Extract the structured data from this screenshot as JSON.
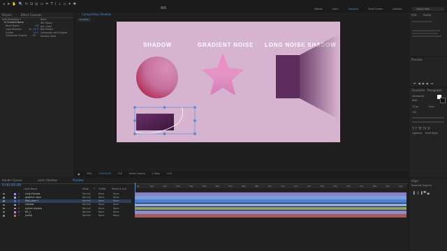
{
  "menu": {
    "items": [
      "Default",
      "Learn",
      "Standard",
      "Small Screen",
      "Libraries"
    ],
    "search_placeholder": "Search Help"
  },
  "project_panel": {
    "tab_project": "Project",
    "tab_effect_controls": "Effect Controls",
    "layer_name": "Solid Backplate 1",
    "effect_title": "fx Gradient Noise",
    "props": [
      {
        "label": "Bevel Depth",
        "value": "100"
      },
      {
        "label": "Light Direction",
        "value": "0x -45.0°"
      },
      {
        "label": "Scatter",
        "value": "10.0"
      },
      {
        "label": "Composite Original",
        "value": "Off"
      }
    ],
    "right_col": [
      "None",
      "Tall Glossy",
      "Adj. Layer",
      "Blur Radius",
      "Composite with Original",
      "Random Seed"
    ]
  },
  "composition": {
    "tab_label": "Composition Shadow",
    "breadcrumb": "Shadow",
    "canvas_titles": {
      "shadow": "SHADOW",
      "gradient": "GRADIENT NOISE",
      "long": "LONG NOISE SHADOW"
    },
    "footer": {
      "zoom": "50%",
      "timecode": "0:00:00:00",
      "quality": "Full",
      "camera": "Active Camera",
      "views": "1 View",
      "offset": "+0.0"
    }
  },
  "right_panel": {
    "info_title": "Info",
    "audio_title": "Audio",
    "preview_title": "Preview",
    "character_title": "Character",
    "paragraph_title": "Paragraph",
    "font": "Montserrat",
    "style": "Bold",
    "size": "72 px",
    "leading": "Auto",
    "tracking": "100",
    "ligatures": "Ligatures",
    "hindi": "Hindi Digits"
  },
  "timeline": {
    "tabs": [
      "Render Queue",
      "Learn Shadow",
      "Shadow"
    ],
    "timecode": "0:00:00:00",
    "columns": [
      "Layer Name",
      "Mode",
      "T",
      "TrkMat",
      "Parent & Link"
    ],
    "layers": [
      {
        "num": "1",
        "name": "Long Shadow",
        "mode": "Normal",
        "trk": "None",
        "parent": "None",
        "color": "#a78bfa"
      },
      {
        "num": "2",
        "name": "gradient noise",
        "mode": "Normal",
        "trk": "None",
        "parent": "None",
        "color": "#8fb3e8"
      },
      {
        "num": "3",
        "name": "Text Layer 1",
        "mode": "Normal",
        "trk": "None",
        "parent": "None",
        "color": "#3a6fd8"
      },
      {
        "num": "4",
        "name": "shadow",
        "mode": "Normal",
        "trk": "None",
        "parent": "None",
        "color": "#8fb3e8"
      },
      {
        "num": "5",
        "name": "sphere shadow",
        "mode": "Normal",
        "trk": "None",
        "parent": "None",
        "color": "#e07a7a"
      },
      {
        "num": "6",
        "name": "BG_1",
        "mode": "Normal",
        "trk": "None",
        "parent": "None",
        "color": "#a78bfa"
      },
      {
        "num": "7",
        "name": "[solid]",
        "mode": "Normal",
        "trk": "None",
        "parent": "None",
        "color": "#c56a6a"
      }
    ],
    "ruler_ticks": [
      "0s",
      "01s",
      "02s",
      "03s",
      "04s",
      "05s",
      "06s",
      "07s",
      "08s",
      "09s",
      "10s",
      "11s",
      "12s",
      "13s",
      "14s",
      "15s",
      "16s",
      "17s",
      "18s",
      "19s",
      "20s"
    ],
    "track_colors": [
      "#8a7fc9",
      "#7a9dd4",
      "#4a7fd8",
      "#8ea8d8",
      "#8da07a",
      "#8a8fc9",
      "#a85a5a"
    ]
  },
  "align": {
    "title": "Align",
    "subtitle": "Essential Graphics"
  }
}
